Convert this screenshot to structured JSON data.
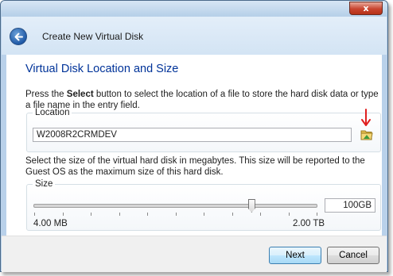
{
  "window": {
    "title": "Create New Virtual Disk",
    "close_glyph": "x"
  },
  "page": {
    "heading": "Virtual Disk Location and Size",
    "intro_prefix": "Press the ",
    "intro_bold": "Select",
    "intro_suffix": " button to select the location of a file to store the hard disk data or type a file name in the entry field."
  },
  "location": {
    "legend": "Location",
    "value": "W2008R2CRMDEV",
    "select_icon": "folder-select-icon",
    "annotation": "red-arrow-annotation"
  },
  "size": {
    "description": "Select the size of the virtual hard disk in megabytes. This size will be reported to the Guest OS as the maximum size of this hard disk.",
    "legend": "Size",
    "min_label": "4.00 MB",
    "max_label": "2.00 TB",
    "value": "100GB",
    "slider_fraction": 0.77
  },
  "buttons": {
    "next": "Next",
    "cancel": "Cancel"
  },
  "colors": {
    "heading": "#003399",
    "arrow": "#e02020"
  }
}
